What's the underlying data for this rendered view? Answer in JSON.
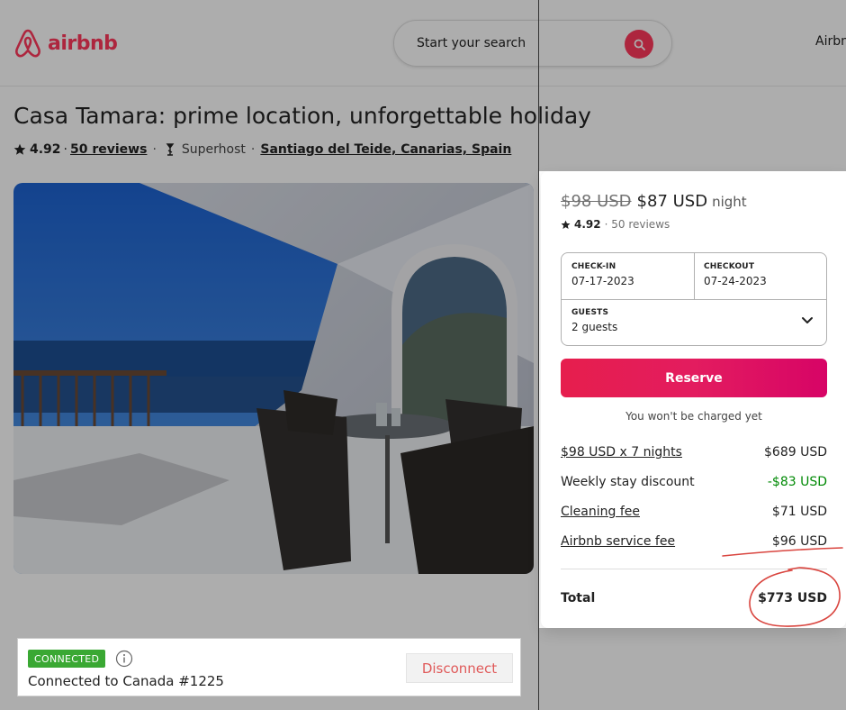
{
  "header": {
    "logo_text": "airbnb",
    "search_placeholder": "Start your search",
    "right_link": "Airbnb"
  },
  "listing": {
    "title": "Casa Tamara: prime location, unforgettable holiday",
    "rating": "4.92",
    "separator": "·",
    "reviews_link": "50 reviews",
    "superhost_label": "Superhost",
    "location_link": "Santiago del Teide, Canarias, Spain"
  },
  "booking": {
    "old_price": "$98 USD",
    "new_price": "$87 USD",
    "per": "night",
    "rating": "4.92",
    "reviews": "· 50 reviews",
    "checkin_label": "CHECK-IN",
    "checkin_value": "07-17-2023",
    "checkout_label": "CHECKOUT",
    "checkout_value": "07-24-2023",
    "guests_label": "GUESTS",
    "guests_value": "2 guests",
    "reserve_label": "Reserve",
    "no_charge_text": "You won't be charged yet",
    "items": [
      {
        "label": "$98 USD x 7 nights",
        "amount": "$689 USD"
      },
      {
        "label": "Weekly stay discount",
        "amount": "-$83 USD"
      },
      {
        "label": "Cleaning fee",
        "amount": "$71 USD"
      },
      {
        "label": "Airbnb service fee",
        "amount": "$96 USD"
      }
    ],
    "total_label": "Total",
    "total_amount": "$773 USD"
  },
  "vpn": {
    "status_badge": "CONNECTED",
    "status_text": "Connected to Canada #1225",
    "disconnect_label": "Disconnect"
  },
  "colors": {
    "brand": "#ff385c",
    "discount_green": "#008a05",
    "vpn_green": "#3aa833",
    "annotation_red": "#d9453f"
  },
  "icons": [
    "airbnb-logo-icon",
    "search-icon",
    "star-icon",
    "superhost-icon",
    "chevron-down-icon",
    "info-icon"
  ]
}
